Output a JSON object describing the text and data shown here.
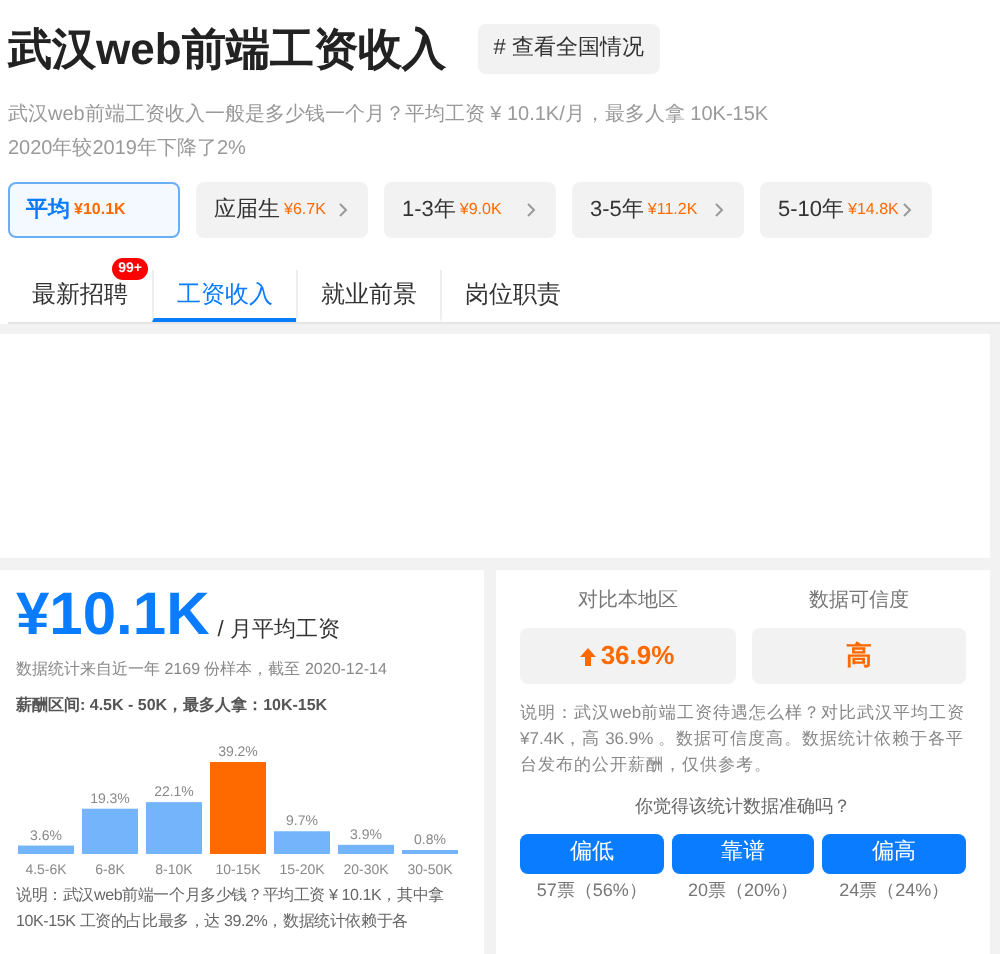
{
  "title": "武汉web前端工资收入",
  "country_link": "# 查看全国情况",
  "summary": [
    "武汉web前端工资收入一般是多少钱一个月？平均工资 ¥ 10.1K/月，最多人拿 10K-15K",
    "2020年较2019年下降了2%"
  ],
  "filters": [
    {
      "label": "平均",
      "value": "¥10.1K",
      "selected": true,
      "arrow": false
    },
    {
      "label": "应届生",
      "value": "¥6.7K",
      "selected": false,
      "arrow": true
    },
    {
      "label": "1-3年",
      "value": "¥9.0K",
      "selected": false,
      "arrow": true
    },
    {
      "label": "3-5年",
      "value": "¥11.2K",
      "selected": false,
      "arrow": true
    },
    {
      "label": "5-10年",
      "value": "¥14.8K",
      "selected": false,
      "arrow": true
    }
  ],
  "tabs": [
    {
      "label": "最新招聘",
      "selected": false,
      "badge": "99+"
    },
    {
      "label": "工资收入",
      "selected": true
    },
    {
      "label": "就业前景",
      "selected": false
    },
    {
      "label": "岗位职责",
      "selected": false
    }
  ],
  "salary_card": {
    "amount": "¥10.1K",
    "unit": "/ 月平均工资",
    "source": "数据统计来自近一年 2169 份样本，截至 2020-12-14",
    "range": "薪酬区间: 4.5K - 50K，最多人拿：10K-15K",
    "chart_data": {
      "type": "bar",
      "categories": [
        "4.5-6K",
        "6-8K",
        "8-10K",
        "10-15K",
        "15-20K",
        "20-30K",
        "30-50K"
      ],
      "stacked": true,
      "series": [
        {
          "color": "#74b4fa",
          "values": [
            3.6,
            19.3,
            22.1,
            null,
            9.7,
            3.9,
            0.8
          ],
          "value_labels": [
            "3.6%",
            "19.3%",
            "22.1%",
            null,
            "9.7%",
            "3.9%",
            "0.8%"
          ]
        },
        {
          "color": "#ff6a00",
          "values": [
            null,
            null,
            null,
            39.2,
            null,
            null,
            null
          ],
          "value_labels": [
            null,
            null,
            null,
            "39.2%",
            null,
            null,
            null
          ]
        }
      ],
      "data_labels": true
    },
    "note": "说明：武汉web前端一个月多少钱？平均工资 ¥ 10.1K，其中拿 10K-15K 工资的占比最多，达 39.2%，数据统计依赖于各"
  },
  "compare_card": {
    "metrics": [
      {
        "label": "对比本地区",
        "value": "36.9%",
        "up": true
      },
      {
        "label": "数据可信度",
        "value": "高"
      }
    ],
    "note": "说明：武汉web前端工资待遇怎么样？对比武汉平均工资 ¥7.4K，高 36.9% 。数据可信度高。数据统计依赖于各平台发布的公开薪酬，仅供参考。",
    "question": "你觉得该统计数据准确吗？",
    "votes": [
      {
        "label": "偏低",
        "count": "57票（56%）"
      },
      {
        "label": "靠谱",
        "count": "20票（20%）"
      },
      {
        "label": "偏高",
        "count": "24票（24%）"
      }
    ]
  }
}
